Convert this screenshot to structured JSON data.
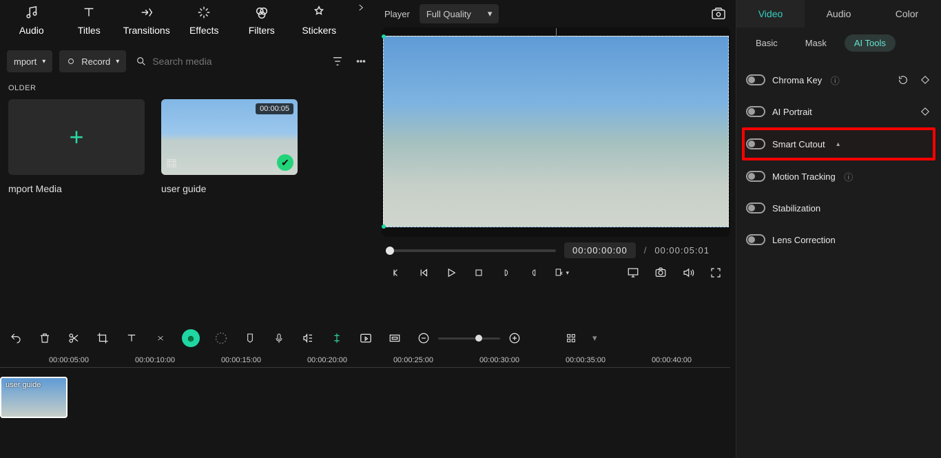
{
  "toolbar": {
    "tabs": [
      "Audio",
      "Titles",
      "Transitions",
      "Effects",
      "Filters",
      "Stickers"
    ],
    "import_label": "mport",
    "record_label": "Record",
    "search_placeholder": "Search media"
  },
  "media": {
    "folder_header": "OLDER",
    "import_card": "mport Media",
    "clips": [
      {
        "label": "user guide",
        "duration": "00:00:05"
      }
    ]
  },
  "player": {
    "label": "Player",
    "quality": "Full Quality",
    "current": "00:00:00:00",
    "separator": "/",
    "total": "00:00:05:01"
  },
  "right": {
    "tabs": [
      "Video",
      "Audio",
      "Color"
    ],
    "subtabs": [
      "Basic",
      "Mask",
      "AI Tools"
    ],
    "tools": {
      "chroma": "Chroma Key",
      "portrait": "AI Portrait",
      "smart_cutout": "Smart Cutout",
      "motion": "Motion Tracking",
      "stabilization": "Stabilization",
      "lens": "Lens Correction"
    }
  },
  "timeline": {
    "marks": [
      "00:00:05:00",
      "00:00:10:00",
      "00:00:15:00",
      "00:00:20:00",
      "00:00:25:00",
      "00:00:30:00",
      "00:00:35:00",
      "00:00:40:00"
    ],
    "clip_label": "user guide"
  }
}
